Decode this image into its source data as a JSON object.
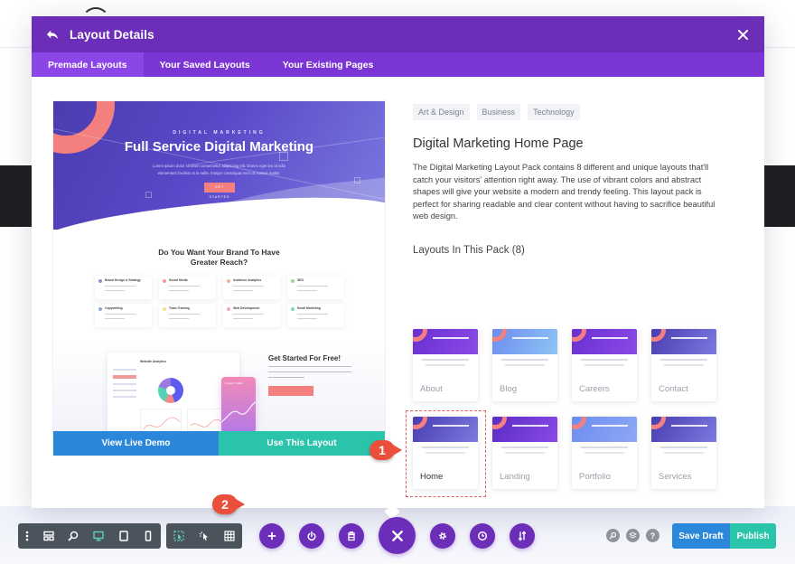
{
  "modal": {
    "title": "Layout Details",
    "tabs": [
      {
        "label": "Premade Layouts",
        "active": true
      },
      {
        "label": "Your Saved Layouts",
        "active": false
      },
      {
        "label": "Your Existing Pages",
        "active": false
      }
    ]
  },
  "preview": {
    "hero_kicker": "DIGITAL MARKETING",
    "hero_title": "Full Service Digital Marketing",
    "hero_subtitle": "Lorem ipsum dolor sit amet consectetur adipiscing elit. Donec eget leo id odio elementum facilisis ut in nulla. Integer consequat enim at massa mattis.",
    "hero_button": "GET STARTED",
    "reach_title": "Do You Want Your Brand To Have Greater Reach?",
    "services": [
      {
        "name": "Brand Design & Strategy",
        "color": "#8e8ed8"
      },
      {
        "name": "Social Media",
        "color": "#f29a9a"
      },
      {
        "name": "Audience Analytics",
        "color": "#f4b09a"
      },
      {
        "name": "SEO",
        "color": "#9ad88e"
      },
      {
        "name": "Copywriting",
        "color": "#8ea4d8"
      },
      {
        "name": "Team Training",
        "color": "#f2e08a"
      },
      {
        "name": "Web Development",
        "color": "#f2a6c2"
      },
      {
        "name": "Email Marketing",
        "color": "#7fd6c2"
      }
    ],
    "dashboard_title": "Website Analytics",
    "phone_text": "Organic Traffic",
    "get_started_title": "Get Started For Free!",
    "view_demo_label": "View Live Demo",
    "use_layout_label": "Use This Layout"
  },
  "details": {
    "tags": [
      "Art & Design",
      "Business",
      "Technology"
    ],
    "title": "Digital Marketing Home Page",
    "description": "The Digital Marketing Layout Pack contains 8 different and unique layouts that'll catch your visitors' attention right away. The use of vibrant colors and abstract shapes will give your website a modern and trendy feeling. This layout pack is perfect for sharing readable and clear content without having to sacrifice beautiful web design.",
    "pack_title": "Layouts In This Pack (8)",
    "layouts": [
      {
        "label": "About",
        "selected": false
      },
      {
        "label": "Blog",
        "selected": false
      },
      {
        "label": "Careers",
        "selected": false
      },
      {
        "label": "Contact",
        "selected": false
      },
      {
        "label": "Home",
        "selected": true
      },
      {
        "label": "Landing",
        "selected": false
      },
      {
        "label": "Portfolio",
        "selected": false
      },
      {
        "label": "Services",
        "selected": false
      }
    ]
  },
  "callouts": {
    "one": "1",
    "two": "2"
  },
  "toolbar": {
    "left_group": [
      "more-options-icon",
      "wireframe-icon",
      "zoom-icon",
      "desktop-icon",
      "tablet-icon",
      "phone-icon"
    ],
    "right_group": [
      "select-icon",
      "click-mode-icon",
      "grid-icon"
    ],
    "center": [
      "add-icon",
      "power-icon",
      "trash-icon",
      "close-icon",
      "settings-icon",
      "history-icon",
      "sort-icon"
    ],
    "help": [
      "search-icon",
      "layers-icon",
      "help-icon"
    ],
    "help_label": "?",
    "save_draft_label": "Save Draft",
    "publish_label": "Publish"
  },
  "colors": {
    "header": "#6c2eb9",
    "tabs": "#7b35d4",
    "active_tab": "#8c45e6",
    "demo_button": "#2b87da",
    "use_button": "#29c4a9",
    "callout": "#ea4f3c"
  }
}
